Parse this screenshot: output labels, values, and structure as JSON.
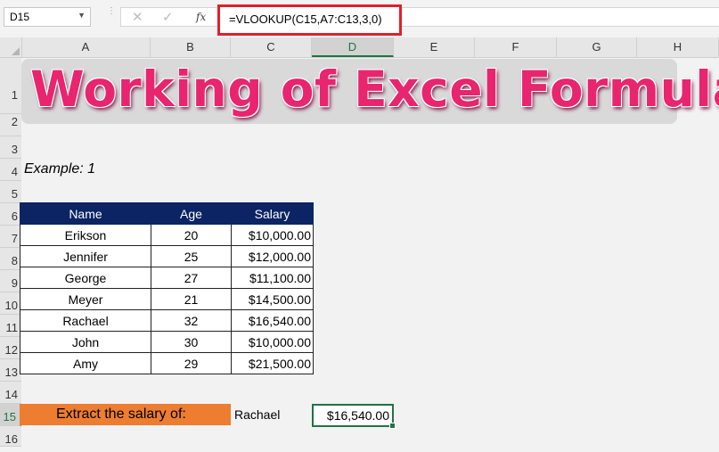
{
  "namebox": {
    "value": "D15"
  },
  "formula": {
    "text": "=VLOOKUP(C15,A7:C13,3,0)",
    "fx_label": "fx"
  },
  "columns": [
    "A",
    "B",
    "C",
    "D",
    "E",
    "F",
    "G",
    "H"
  ],
  "rows": [
    "1",
    "2",
    "3",
    "4",
    "5",
    "6",
    "7",
    "8",
    "9",
    "10",
    "11",
    "12",
    "13",
    "14",
    "15",
    "16"
  ],
  "title": "Working of Excel Formula",
  "example_label": "Example: 1",
  "table": {
    "headers": [
      "Name",
      "Age",
      "Salary"
    ],
    "rows": [
      [
        "Erikson",
        "20",
        "$10,000.00"
      ],
      [
        "Jennifer",
        "25",
        "$12,000.00"
      ],
      [
        "George",
        "27",
        "$11,100.00"
      ],
      [
        "Meyer",
        "21",
        "$14,500.00"
      ],
      [
        "Rachael",
        "32",
        "$16,540.00"
      ],
      [
        "John",
        "30",
        "$10,000.00"
      ],
      [
        "Amy",
        "29",
        "$21,500.00"
      ]
    ]
  },
  "lookup": {
    "label": "Extract the salary of:",
    "input_value": "Rachael",
    "result": "$16,540.00"
  },
  "colors": {
    "header_fill": "#0c2463",
    "label_fill": "#ed7d31",
    "title_color": "#e8256e",
    "selection": "#217346",
    "formula_highlight": "#e0202a"
  },
  "icons": [
    "cancel-icon",
    "enter-icon",
    "insert-function-icon",
    "dropdown-arrow-icon"
  ]
}
